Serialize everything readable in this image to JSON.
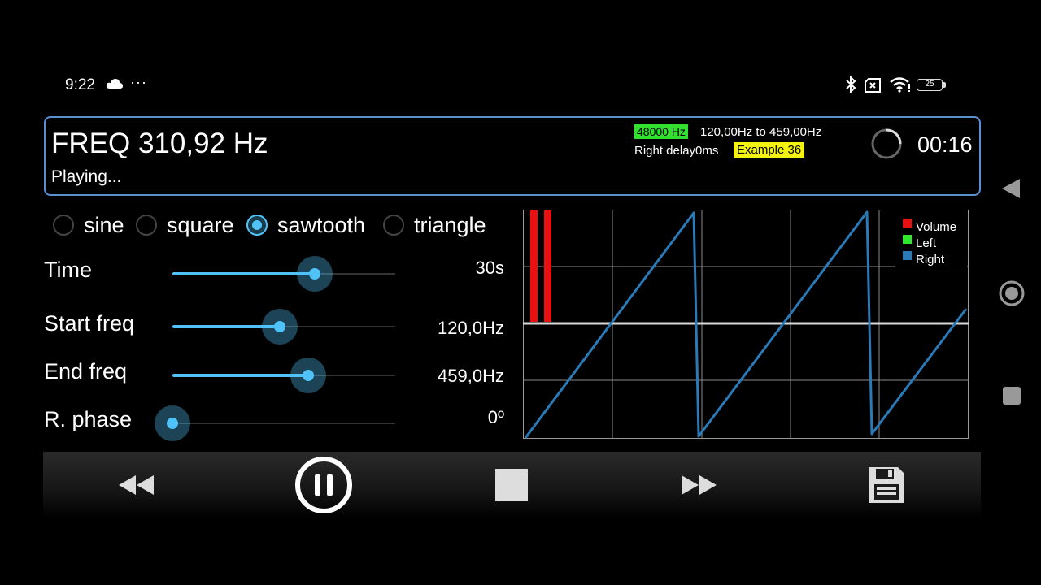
{
  "status_bar": {
    "time": "9:22",
    "more": "···",
    "battery": "25",
    "icons": [
      "cloud-icon",
      "bluetooth-icon",
      "no-sim-icon",
      "wifi-icon",
      "battery-icon"
    ]
  },
  "header": {
    "freq": "FREQ 310,92 Hz",
    "state": "Playing...",
    "sample_rate": "48000 Hz",
    "range": "120,00Hz to 459,00Hz",
    "delay": "Right delay0ms",
    "example": "Example 36",
    "elapsed": "00:16"
  },
  "waveforms": [
    {
      "label": "sine",
      "selected": false
    },
    {
      "label": "square",
      "selected": false
    },
    {
      "label": "sawtooth",
      "selected": true
    },
    {
      "label": "triangle",
      "selected": false
    }
  ],
  "sliders": [
    {
      "label": "Time",
      "value": "30s",
      "position": 0.64
    },
    {
      "label": "Start freq",
      "value": "120,0Hz",
      "position": 0.48
    },
    {
      "label": "End freq",
      "value": "459,0Hz",
      "position": 0.61
    },
    {
      "label": "R. phase",
      "value": "0º",
      "position": 0.0
    }
  ],
  "legend": [
    {
      "label": "Volume",
      "color": "#e81010"
    },
    {
      "label": "Left",
      "color": "#2ee82e"
    },
    {
      "label": "Right",
      "color": "#2a7ab8"
    }
  ],
  "colors": {
    "accent": "#4fc3f7",
    "header_border": "#5a8fd6",
    "rate_badge": "#32e02f",
    "example_badge": "#f4f20f"
  },
  "transport": [
    {
      "name": "rewind-button",
      "icon": "rewind-icon"
    },
    {
      "name": "pause-button",
      "icon": "pause-icon"
    },
    {
      "name": "stop-button",
      "icon": "stop-icon"
    },
    {
      "name": "fast-forward-button",
      "icon": "fast-forward-icon"
    },
    {
      "name": "save-button",
      "icon": "save-icon"
    }
  ],
  "nav": [
    "back-icon",
    "home-icon",
    "recents-icon"
  ]
}
